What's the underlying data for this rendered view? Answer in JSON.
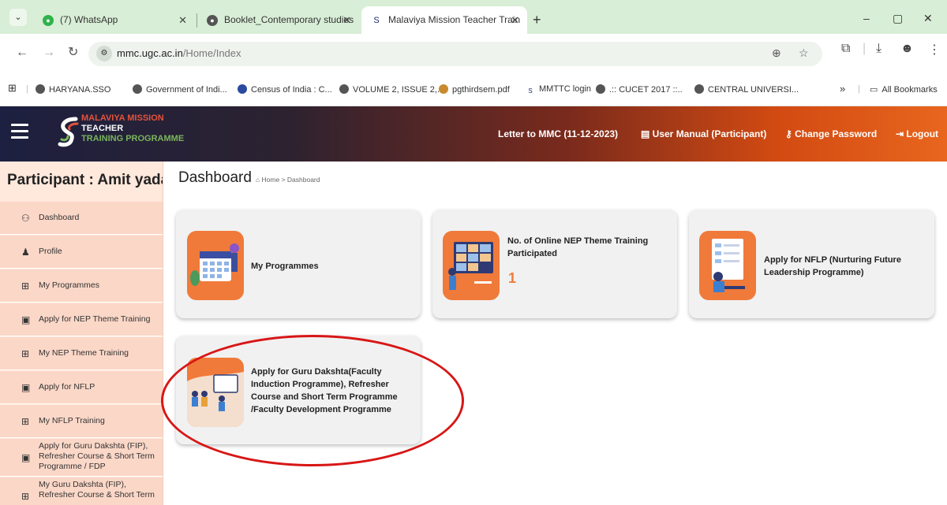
{
  "browser": {
    "tabs": [
      {
        "title": "(7) WhatsApp",
        "active": false
      },
      {
        "title": "Booklet_Contemporary studies",
        "active": false
      },
      {
        "title": "Malaviya Mission Teacher Train",
        "active": true
      }
    ],
    "new_tab_label": "+",
    "window_controls": {
      "minimize": "–",
      "restore": "▢",
      "close": "✕"
    },
    "url_host": "mmc.ugc.ac.in",
    "url_path": "/Home/Index",
    "bookmarks": [
      "HARYANA.SSO",
      "Government of Indi...",
      "Census of India : C...",
      "VOLUME 2, ISSUE 2,...",
      "pgthirdsem.pdf",
      "MMTTC login",
      ".:: CUCET 2017 ::..",
      "CENTRAL UNIVERSI..."
    ],
    "bookmarks_overflow": "»",
    "all_bookmarks": "All Bookmarks"
  },
  "header": {
    "logo_line1": "MALAVIYA MISSION",
    "logo_line2": "TEACHER",
    "logo_line3": "TRAINING PROGRAMME",
    "letter_link": "Letter to MMC (11-12-2023)",
    "manual_link": "User Manual (Participant)",
    "change_password": "Change Password",
    "logout": "Logout"
  },
  "sidebar": {
    "participant": "Participant : Amit yadav",
    "items": [
      {
        "label": "Dashboard",
        "icon": "dashboard-icon"
      },
      {
        "label": "Profile",
        "icon": "user-icon"
      },
      {
        "label": "My Programmes",
        "icon": "grid-icon"
      },
      {
        "label": "Apply for NEP Theme Training",
        "icon": "form-icon"
      },
      {
        "label": "My NEP Theme Training",
        "icon": "grid-icon"
      },
      {
        "label": "Apply for NFLP",
        "icon": "form-icon"
      },
      {
        "label": "My NFLP Training",
        "icon": "grid-icon"
      },
      {
        "label": "Apply for Guru Dakshta (FIP), Refresher Course & Short Term Programme / FDP",
        "icon": "form-icon"
      },
      {
        "label": "My Guru Dakshta (FIP), Refresher Course & Short Term",
        "icon": "grid-icon"
      }
    ]
  },
  "main": {
    "title": "Dashboard",
    "breadcrumb_home": "Home",
    "breadcrumb_sep": ">",
    "breadcrumb_current": "Dashboard",
    "cards": [
      {
        "title": "My Programmes"
      },
      {
        "title": "No. of Online NEP Theme Training Participated",
        "count": "1"
      },
      {
        "title": "Apply for NFLP (Nurturing Future Leadership Programme)"
      },
      {
        "title": "Apply for Guru Dakshta(Faculty Induction Programme), Refresher Course and Short Term Programme /Faculty Development Programme"
      }
    ]
  },
  "colors": {
    "accent_orange": "#f07a3a",
    "sidebar_bg": "#ffe8dc",
    "annotation_red": "#d81616"
  }
}
